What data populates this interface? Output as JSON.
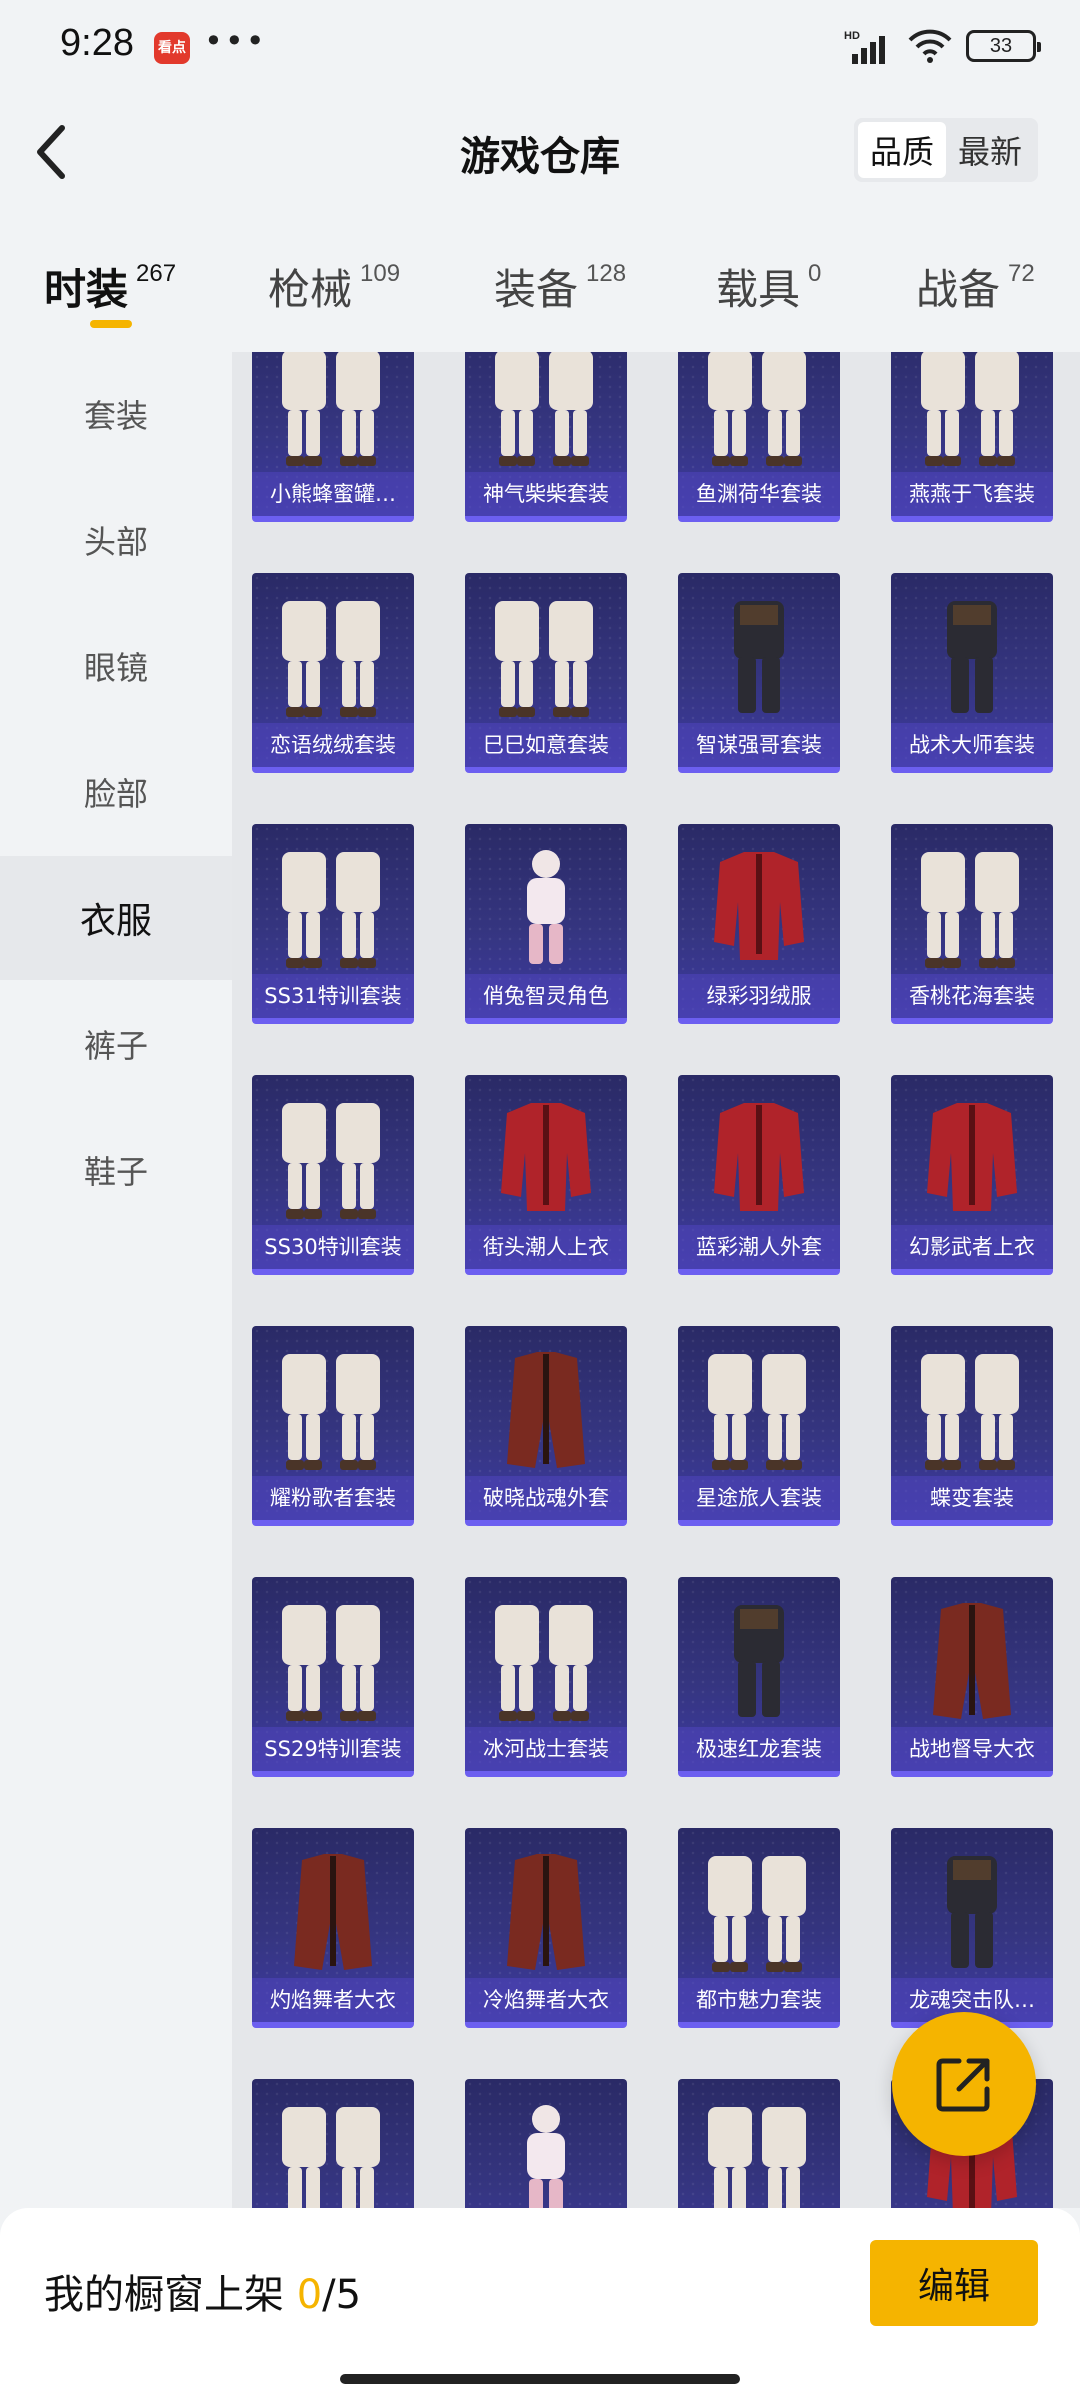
{
  "status_bar": {
    "time": "9:28",
    "app_badge": "看点",
    "more": "•••",
    "network": "HD",
    "battery": "33"
  },
  "header": {
    "title": "游戏仓库",
    "sort_options": [
      "品质",
      "最新"
    ],
    "active_sort": "品质"
  },
  "tabs": [
    {
      "label": "时装",
      "count": "267",
      "active": true
    },
    {
      "label": "枪械",
      "count": "109",
      "active": false
    },
    {
      "label": "装备",
      "count": "128",
      "active": false
    },
    {
      "label": "载具",
      "count": "0",
      "active": false
    },
    {
      "label": "战备",
      "count": "72",
      "active": false
    }
  ],
  "sidebar": {
    "items": [
      "套装",
      "头部",
      "眼镜",
      "脸部",
      "衣服",
      "裤子",
      "鞋子"
    ],
    "active": "衣服"
  },
  "items": [
    {
      "name": "小熊蜂蜜罐…",
      "icon": "outfit-set-icon"
    },
    {
      "name": "神气柴柴套装",
      "icon": "outfit-set-icon"
    },
    {
      "name": "鱼渊荷华套装",
      "icon": "outfit-set-icon"
    },
    {
      "name": "燕燕于飞套装",
      "icon": "outfit-set-icon"
    },
    {
      "name": "恋语绒绒套装",
      "icon": "outfit-set-icon"
    },
    {
      "name": "巳巳如意套装",
      "icon": "outfit-set-icon"
    },
    {
      "name": "智谋强哥套装",
      "icon": "outfit-single-icon"
    },
    {
      "name": "战术大师套装",
      "icon": "outfit-single-icon"
    },
    {
      "name": "SS31特训套装",
      "icon": "outfit-set-icon"
    },
    {
      "name": "俏兔智灵角色",
      "icon": "character-icon"
    },
    {
      "name": "绿彩羽绒服",
      "icon": "jacket-icon"
    },
    {
      "name": "香桃花海套装",
      "icon": "outfit-set-icon"
    },
    {
      "name": "SS30特训套装",
      "icon": "outfit-set-icon"
    },
    {
      "name": "街头潮人上衣",
      "icon": "jacket-icon"
    },
    {
      "name": "蓝彩潮人外套",
      "icon": "jacket-icon"
    },
    {
      "name": "幻影武者上衣",
      "icon": "jacket-icon"
    },
    {
      "name": "耀粉歌者套装",
      "icon": "outfit-set-icon"
    },
    {
      "name": "破晓战魂外套",
      "icon": "coat-icon"
    },
    {
      "name": "星途旅人套装",
      "icon": "outfit-set-icon"
    },
    {
      "name": "蝶变套装",
      "icon": "outfit-set-icon"
    },
    {
      "name": "SS29特训套装",
      "icon": "outfit-set-icon"
    },
    {
      "name": "冰河战士套装",
      "icon": "outfit-set-icon"
    },
    {
      "name": "极速红龙套装",
      "icon": "outfit-single-icon"
    },
    {
      "name": "战地督导大衣",
      "icon": "coat-icon"
    },
    {
      "name": "灼焰舞者大衣",
      "icon": "coat-icon"
    },
    {
      "name": "冷焰舞者大衣",
      "icon": "coat-icon"
    },
    {
      "name": "都市魅力套装",
      "icon": "outfit-set-icon"
    },
    {
      "name": "龙魂突击队…",
      "icon": "outfit-single-icon"
    },
    {
      "name": "",
      "icon": "outfit-set-icon"
    },
    {
      "name": "",
      "icon": "character-icon"
    },
    {
      "name": "",
      "icon": "outfit-set-icon"
    },
    {
      "name": "",
      "icon": "jacket-icon"
    }
  ],
  "bottom_bar": {
    "showcase_label": "我的橱窗上架",
    "showcase_count": "0",
    "showcase_total": "/5",
    "edit_label": "编辑"
  },
  "colors": {
    "accent": "#f5b400",
    "card_top": "#2a2a66",
    "card_bottom": "#3d3aa0",
    "card_border": "#6c5ff0"
  }
}
